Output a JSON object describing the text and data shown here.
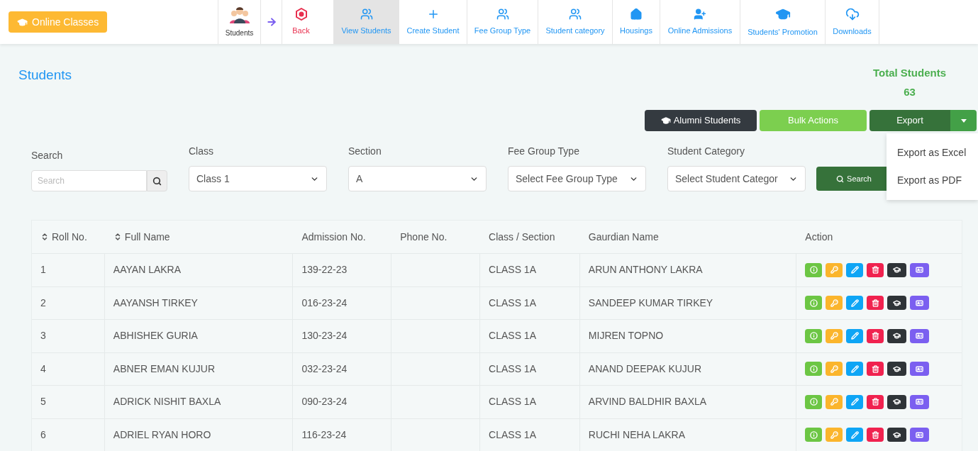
{
  "top_button": {
    "label": "Online Classes"
  },
  "nav": [
    {
      "kind": "avatar",
      "label": "Students",
      "selected": false
    },
    {
      "kind": "arrow",
      "selected": false
    },
    {
      "kind": "back",
      "label": "Back",
      "selected": false
    },
    {
      "kind": "users",
      "label": "View Students",
      "selected": true
    },
    {
      "kind": "plus",
      "label": "Create Student",
      "selected": false
    },
    {
      "kind": "users",
      "label": "Fee Group Type",
      "selected": false
    },
    {
      "kind": "users",
      "label": "Student category",
      "selected": false
    },
    {
      "kind": "home",
      "label": "Housings",
      "selected": false
    },
    {
      "kind": "user-plus",
      "label": "Online Admissions",
      "selected": false
    },
    {
      "kind": "cap",
      "label": "Students' Promotion",
      "selected": false
    },
    {
      "kind": "download",
      "label": "Downloads",
      "selected": false
    }
  ],
  "page_title": "Students",
  "total": {
    "label": "Total Students",
    "value": "63"
  },
  "actions": {
    "alumni": "Alumni Students",
    "bulk": "Bulk Actions",
    "export": "Export",
    "export_menu": [
      "Export as Excel",
      "Export as PDF"
    ]
  },
  "filters": {
    "search": {
      "label": "Search",
      "placeholder": "Search"
    },
    "selects": [
      {
        "label": "Class",
        "value": "Class 1"
      },
      {
        "label": "Section",
        "value": "A"
      },
      {
        "label": "Fee Group Type",
        "value": "Select Fee Group Type"
      },
      {
        "label": "Student Category",
        "value": "Select Student Categor"
      }
    ],
    "button": "Search"
  },
  "table": {
    "columns": [
      {
        "label": "Roll No.",
        "sortable": true
      },
      {
        "label": "Full Name",
        "sortable": true
      },
      {
        "label": "Admission No.",
        "sortable": false
      },
      {
        "label": "Phone No.",
        "sortable": false
      },
      {
        "label": "Class / Section",
        "sortable": false
      },
      {
        "label": "Gaurdian Name",
        "sortable": false
      },
      {
        "label": "Action",
        "sortable": false
      }
    ],
    "action_buttons": [
      {
        "kind": "info",
        "color": "#6cc644"
      },
      {
        "kind": "key",
        "color": "#fbb52c"
      },
      {
        "kind": "edit",
        "color": "#0ea5f5"
      },
      {
        "kind": "delete",
        "color": "#f0224f"
      },
      {
        "kind": "graduate",
        "color": "#2f3438"
      },
      {
        "kind": "id-card",
        "color": "#7b5ff0"
      }
    ],
    "rows": [
      [
        "1",
        "AAYAN LAKRA",
        "139-22-23",
        "",
        "CLASS 1A",
        "ARUN ANTHONY LAKRA"
      ],
      [
        "2",
        "AAYANSH TIRKEY",
        "016-23-24",
        "",
        "CLASS 1A",
        "SANDEEP KUMAR TIRKEY"
      ],
      [
        "3",
        "ABHISHEK GURIA",
        "130-23-24",
        "",
        "CLASS 1A",
        "MIJREN TOPNO"
      ],
      [
        "4",
        "ABNER EMAN KUJUR",
        "032-23-24",
        "",
        "CLASS 1A",
        "ANAND DEEPAK KUJUR"
      ],
      [
        "5",
        "ADRICK NISHIT BAXLA",
        "090-23-24",
        "",
        "CLASS 1A",
        "ARVIND BALDHIR BAXLA"
      ],
      [
        "6",
        "ADRIEL RYAN HORO",
        "116-23-24",
        "",
        "CLASS 1A",
        "RUCHI NEHA LAKRA"
      ]
    ]
  }
}
